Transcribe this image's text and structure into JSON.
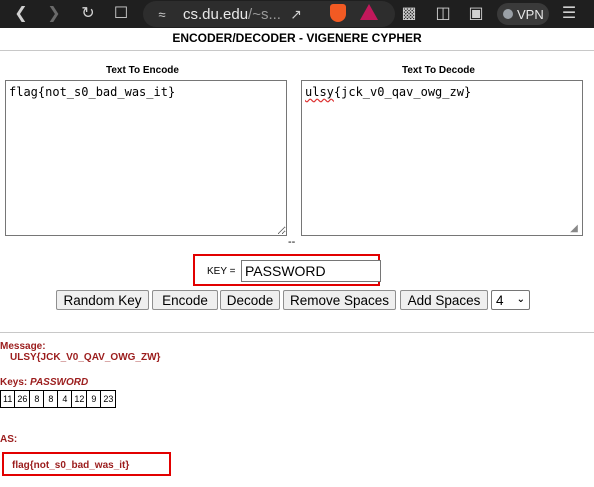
{
  "browser": {
    "url_host": "cs.du.edu",
    "url_rest": "/~s...",
    "vpn_label": "VPN"
  },
  "page": {
    "title": "ENCODER/DECODER - VIGENERE CYPHER",
    "encode_label": "Text To Encode",
    "decode_label": "Text To Decode",
    "encode_value": "flag{not_s0_bad_was_it}",
    "decode_word1": "ulsy",
    "decode_rest": "{jck_v0_qav_owg_zw}",
    "separator": "--",
    "key_label": "KEY =",
    "key_value": "PASSWORD"
  },
  "buttons": {
    "random_key": "Random Key",
    "encode": "Encode",
    "decode": "Decode",
    "remove_spaces": "Remove Spaces",
    "add_spaces": "Add Spaces",
    "group_size": "4"
  },
  "results": {
    "message_label": "Message:",
    "message_value": "ULSY{JCK_V0_QAV_OWG_ZW}",
    "keys_label": "Keys:",
    "keys_value": "PASSWORD",
    "key_numbers": [
      "11",
      "26",
      "8",
      "8",
      "4",
      "12",
      "9",
      "23"
    ],
    "as_label": "AS:",
    "answer": "flag{not_s0_bad_was_it}"
  },
  "colors": {
    "accent_red": "#e20000",
    "result_text": "#9b1c1c"
  }
}
